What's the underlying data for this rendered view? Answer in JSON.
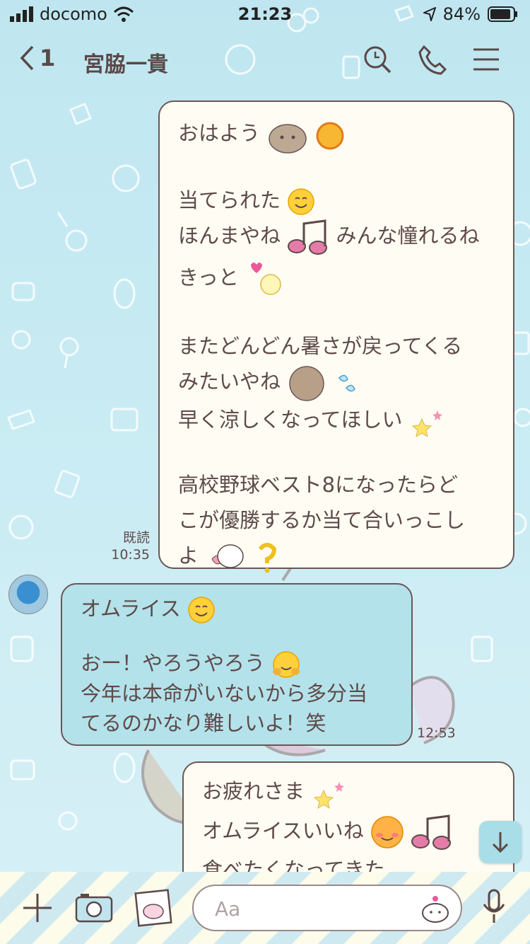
{
  "status_bar": {
    "carrier": "docomo",
    "time": "21:23",
    "battery": "84%"
  },
  "header": {
    "back_count": "1",
    "title": "宮脇一貴",
    "icons": [
      "search-icon",
      "phone-icon",
      "menu-icon"
    ]
  },
  "messages": [
    {
      "side": "me",
      "read_label": "既読",
      "time": "10:35",
      "lines": [
        "おはよう",
        "",
        "当てられた",
        "ほんまやね",
        "きっと",
        "",
        "またどんどん暑さが戻ってくる",
        "みたいやね",
        "早く涼しくなってほしい",
        "",
        "高校野球ベスト8になったらど",
        "こが優勝するか当て合いっこし",
        "よ"
      ],
      "inline_after_line4": "みんな憧れるね"
    },
    {
      "side": "them",
      "time": "12:53",
      "lines": [
        "オムライス",
        "",
        "おー！やろうやろう",
        "今年は本命がいないから多分当",
        "てるのかなり難しいよ！笑"
      ]
    },
    {
      "side": "me",
      "lines": [
        "お疲れさま",
        "オムライスいいね",
        "食べたくなってきた"
      ]
    }
  ],
  "input": {
    "placeholder": "Aa"
  },
  "colors": {
    "background": "#c8ebf3",
    "my_bubble": "#fffdf3",
    "their_bubble": "#b4e2ea",
    "border": "#6b5656",
    "text": "#5e4a4a"
  }
}
